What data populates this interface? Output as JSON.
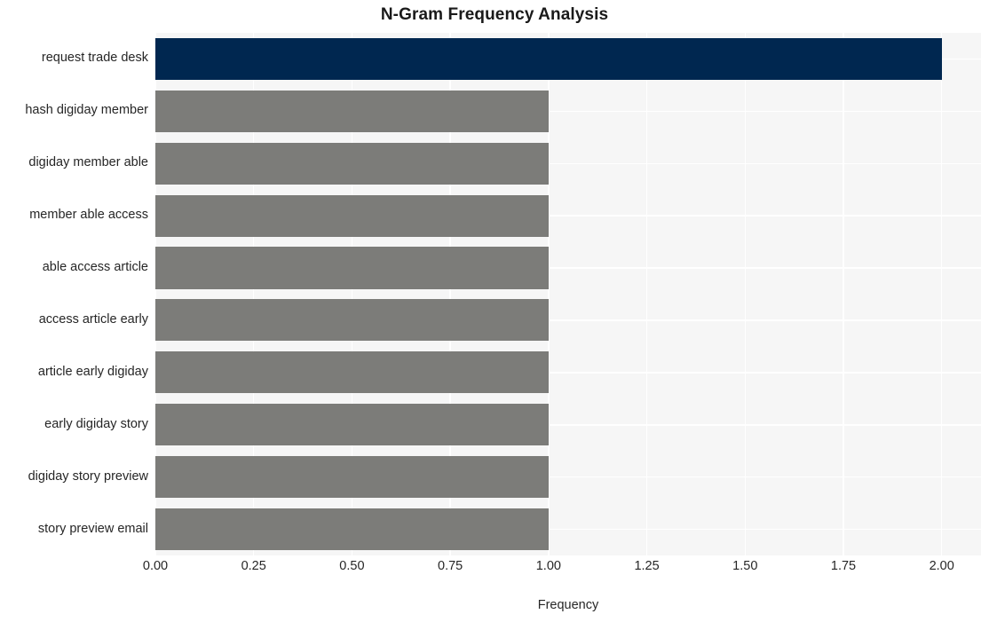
{
  "chart_data": {
    "type": "bar",
    "orientation": "horizontal",
    "title": "N-Gram Frequency Analysis",
    "xlabel": "Frequency",
    "ylabel": "",
    "categories": [
      "request trade desk",
      "hash digiday member",
      "digiday member able",
      "member able access",
      "able access article",
      "access article early",
      "article early digiday",
      "early digiday story",
      "digiday story preview",
      "story preview email"
    ],
    "values": [
      2,
      1,
      1,
      1,
      1,
      1,
      1,
      1,
      1,
      1
    ],
    "bar_colors": [
      "#002750",
      "#7c7c79",
      "#7c7c79",
      "#7c7c79",
      "#7c7c79",
      "#7c7c79",
      "#7c7c79",
      "#7c7c79",
      "#7c7c79",
      "#7c7c79"
    ],
    "xlim": [
      0.0,
      2.1
    ],
    "xticks": [
      0.0,
      0.25,
      0.5,
      0.75,
      1.0,
      1.25,
      1.5,
      1.75,
      2.0
    ],
    "xtick_labels": [
      "0.00",
      "0.25",
      "0.50",
      "0.75",
      "1.00",
      "1.25",
      "1.50",
      "1.75",
      "2.00"
    ],
    "grid": true,
    "grid_color": "#ffffff",
    "plot_background": "#f6f6f6",
    "figure_background": "#ffffff",
    "legend": null
  }
}
